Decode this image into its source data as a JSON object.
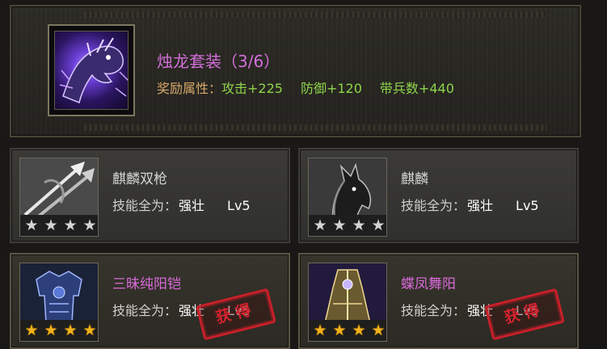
{
  "set": {
    "icon": "dragon-emblem-icon",
    "title": "烛龙套装（3/6）",
    "bonus_label": "奖励属性：",
    "bonuses": [
      "攻击+225",
      "防御+120",
      "带兵数+440"
    ]
  },
  "items": [
    {
      "name": "麒麟双枪",
      "icon": "twin-spear-icon",
      "skill_label": "技能全为：",
      "skill_value": "强壮",
      "level": "Lv5",
      "stars": 4,
      "star_color": "#d4d4d4",
      "obtained": false
    },
    {
      "name": "麒麟",
      "icon": "horse-mount-icon",
      "skill_label": "技能全为：",
      "skill_value": "强壮",
      "level": "Lv5",
      "stars": 4,
      "star_color": "#d4d4d4",
      "obtained": false
    },
    {
      "name": "三昧纯阳铠",
      "icon": "armor-icon",
      "skill_label": "技能全为：",
      "skill_value": "强壮",
      "level": "Lv5",
      "stars": 4,
      "star_color": "#f2b21a",
      "obtained": true,
      "stamp": "获得"
    },
    {
      "name": "蝶凤舞阳",
      "icon": "robe-icon",
      "skill_label": "技能全为：",
      "skill_value": "强壮",
      "level": "Lv5",
      "stars": 4,
      "star_color": "#f2b21a",
      "obtained": true,
      "stamp": "获得"
    }
  ],
  "colors": {
    "set_title": "#d26fd8",
    "bonus_value": "#8fd44b",
    "bonus_label": "#d9a86a",
    "purple_name": "#d86ad8",
    "stamp": "#d6222e"
  }
}
